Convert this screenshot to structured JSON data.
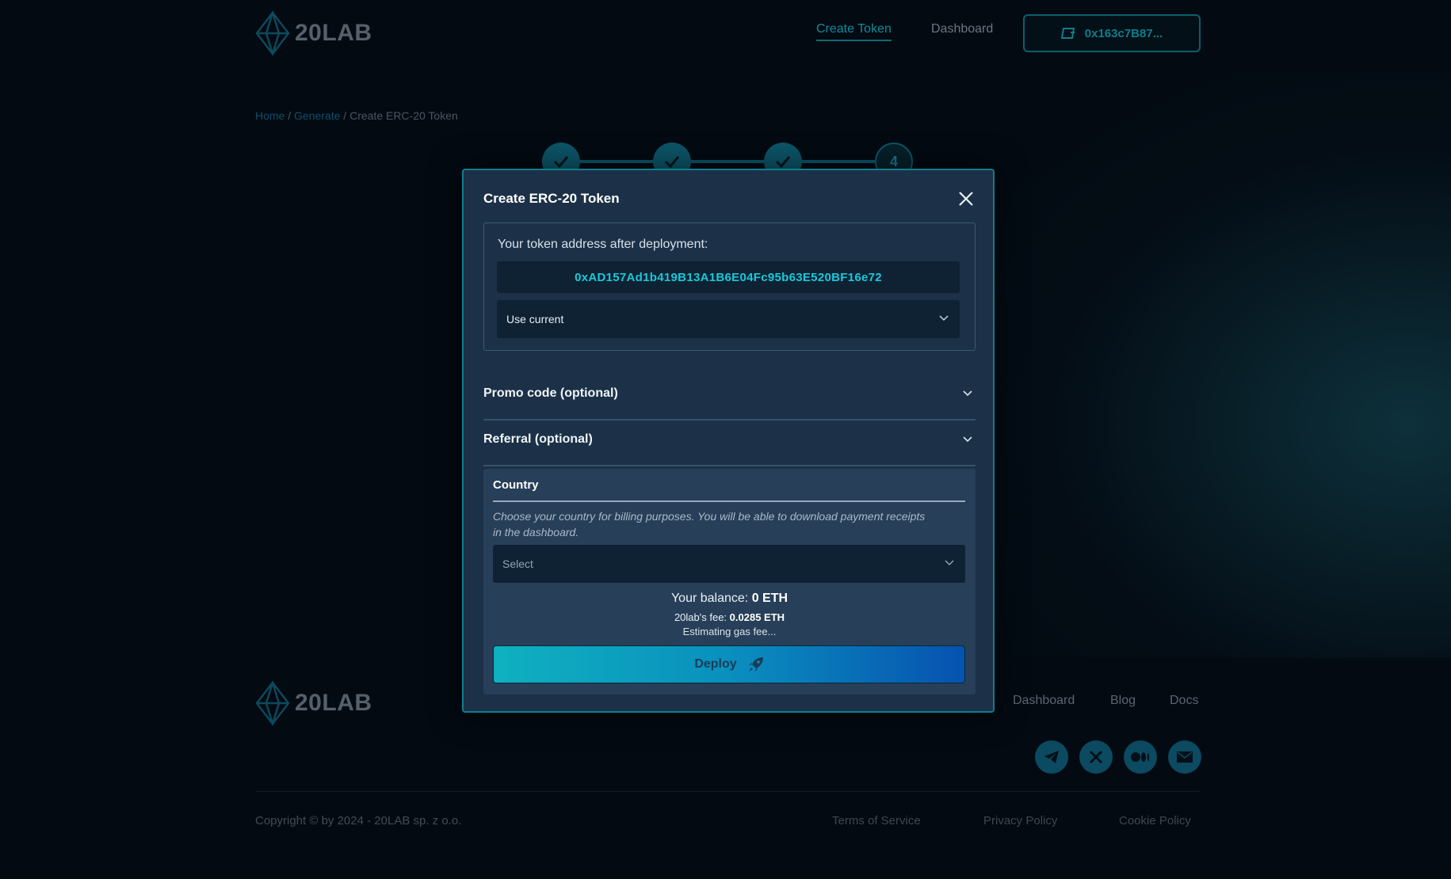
{
  "brand": {
    "name": "20LAB"
  },
  "header": {
    "nav": [
      {
        "label": "Create Token",
        "active": true
      },
      {
        "label": "Dashboard",
        "active": false
      }
    ],
    "wallet_label": "0x163c7B87..."
  },
  "breadcrumb": {
    "home": "Home",
    "sep1": "/",
    "generate": "Generate",
    "sep2": "/",
    "current": "Create ERC-20 Token"
  },
  "stepper": {
    "steps": [
      "done",
      "done",
      "done",
      "4"
    ]
  },
  "modal": {
    "title": "Create ERC-20 Token",
    "address_label": "Your token address after deployment:",
    "address_value": "0xAD157Ad1b419B13A1B6E04Fc95b63E520BF16e72",
    "address_mode": "Use current",
    "promo_label": "Promo code (optional)",
    "referral_label": "Referral (optional)",
    "country": {
      "title": "Country",
      "help": "Choose your country for billing purposes. You will be able to download payment receipts in the dashboard.",
      "placeholder": "Select"
    },
    "balance_label": "Your balance:",
    "balance_value": "0 ETH",
    "fee_label": "20lab's fee:",
    "fee_value": "0.0285 ETH",
    "gas_text": "Estimating gas fee...",
    "deploy_label": "Deploy"
  },
  "footer": {
    "links": [
      "Dashboard",
      "Blog",
      "Docs"
    ],
    "socials": [
      "telegram-icon",
      "x-icon",
      "medium-icon",
      "mail-icon"
    ],
    "copyright": "Copyright © by 2024 - 20LAB sp. z o.o.",
    "legal": [
      "Terms of Service",
      "Privacy Policy",
      "Cookie Policy"
    ]
  },
  "colors": {
    "accent": "#19c9d8",
    "modal_bg": "#1c3147",
    "modal_border": "#0b7f90",
    "page_bg": "#030a12"
  }
}
